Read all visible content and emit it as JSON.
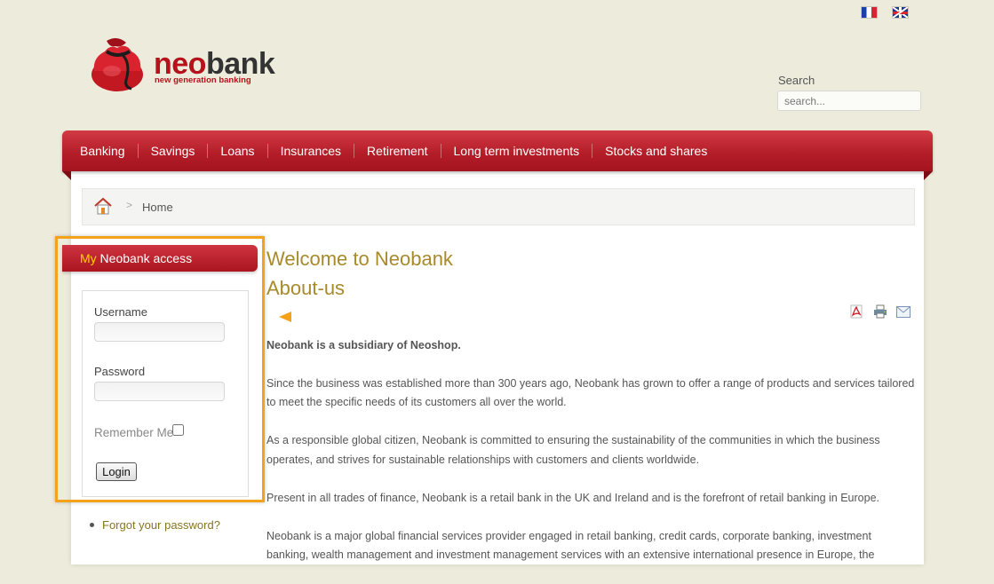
{
  "header": {
    "languages": [
      {
        "name": "fr-flag-icon",
        "label": "Français"
      },
      {
        "name": "uk-flag-icon",
        "label": "English"
      }
    ],
    "logo": {
      "word_neo": "neo",
      "word_bank": "bank",
      "tagline": "new generation banking"
    },
    "search": {
      "label": "Search",
      "placeholder": "search..."
    }
  },
  "nav": {
    "items": [
      "Banking",
      "Savings",
      "Loans",
      "Insurances",
      "Retirement",
      "Long term investments",
      "Stocks and shares"
    ]
  },
  "breadcrumb": {
    "current": "Home",
    "separator": ">"
  },
  "login_module": {
    "title_highlight": "My",
    "title_rest": " Neobank access",
    "username_label": "Username",
    "password_label": "Password",
    "remember_label": "Remember Me",
    "remember_checked": false,
    "login_button": "Login",
    "forgot_link": "Forgot your password?"
  },
  "article": {
    "title": "Welcome to Neobank",
    "subtitle": "About-us",
    "lead": "Neobank is a subsidiary of Neoshop.",
    "paragraphs": [
      "Since the business was established more than 300 years ago, Neobank has grown to offer a range of products and services tailored to meet the specific needs of its customers all over the world.",
      "As a responsible global citizen, Neobank is committed to ensuring the sustainability of the communities in which the business operates, and strives for sustainable relationships with customers and clients worldwide.",
      "Present in all trades of finance, Neobank is a retail bank in the UK and Ireland and is the forefront of retail banking in Europe.",
      "Neobank is a major global financial services provider engaged in retail banking, credit cards, corporate banking, investment banking, wealth management and investment management services with an extensive international presence in Europe, the"
    ],
    "action_icons": [
      "pdf-icon",
      "print-icon",
      "email-icon"
    ]
  },
  "colors": {
    "brand_red": "#b5121b",
    "heading_gold": "#a88a2a",
    "highlight_orange": "#f5a21b",
    "page_bg": "#edecdc"
  }
}
